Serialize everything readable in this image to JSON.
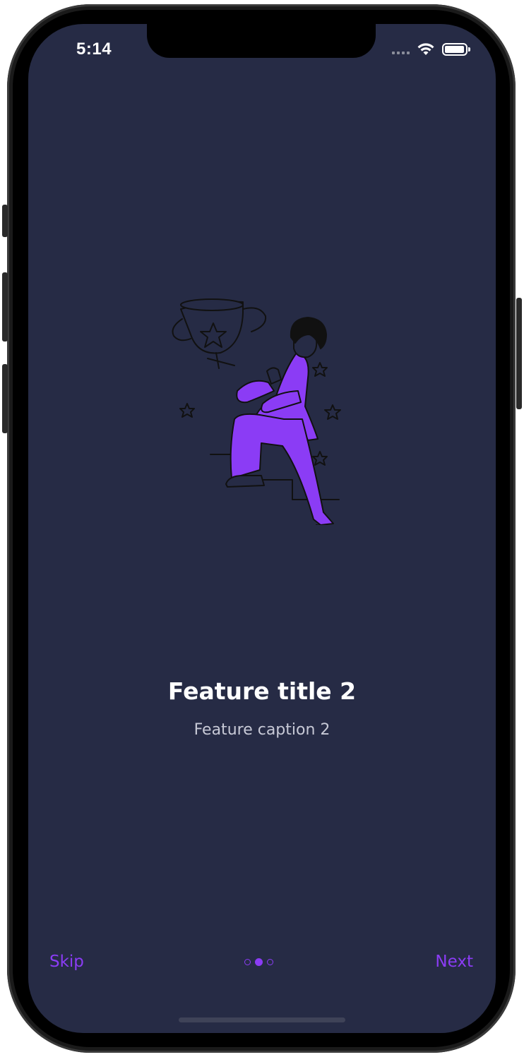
{
  "status_bar": {
    "time": "5:14",
    "icons": [
      "signal-icon",
      "wifi-icon",
      "battery-icon"
    ]
  },
  "illustration": {
    "icon": "trophy-person-climbing-stairs-illustration"
  },
  "feature": {
    "title": "Feature title 2",
    "caption": "Feature caption 2"
  },
  "footer": {
    "skip_label": "Skip",
    "next_label": "Next",
    "page_count": 3,
    "active_page": 2
  },
  "colors": {
    "background": "#262b45",
    "accent": "#8b3cf5",
    "title": "#ffffff",
    "caption": "#c7c9d6"
  }
}
